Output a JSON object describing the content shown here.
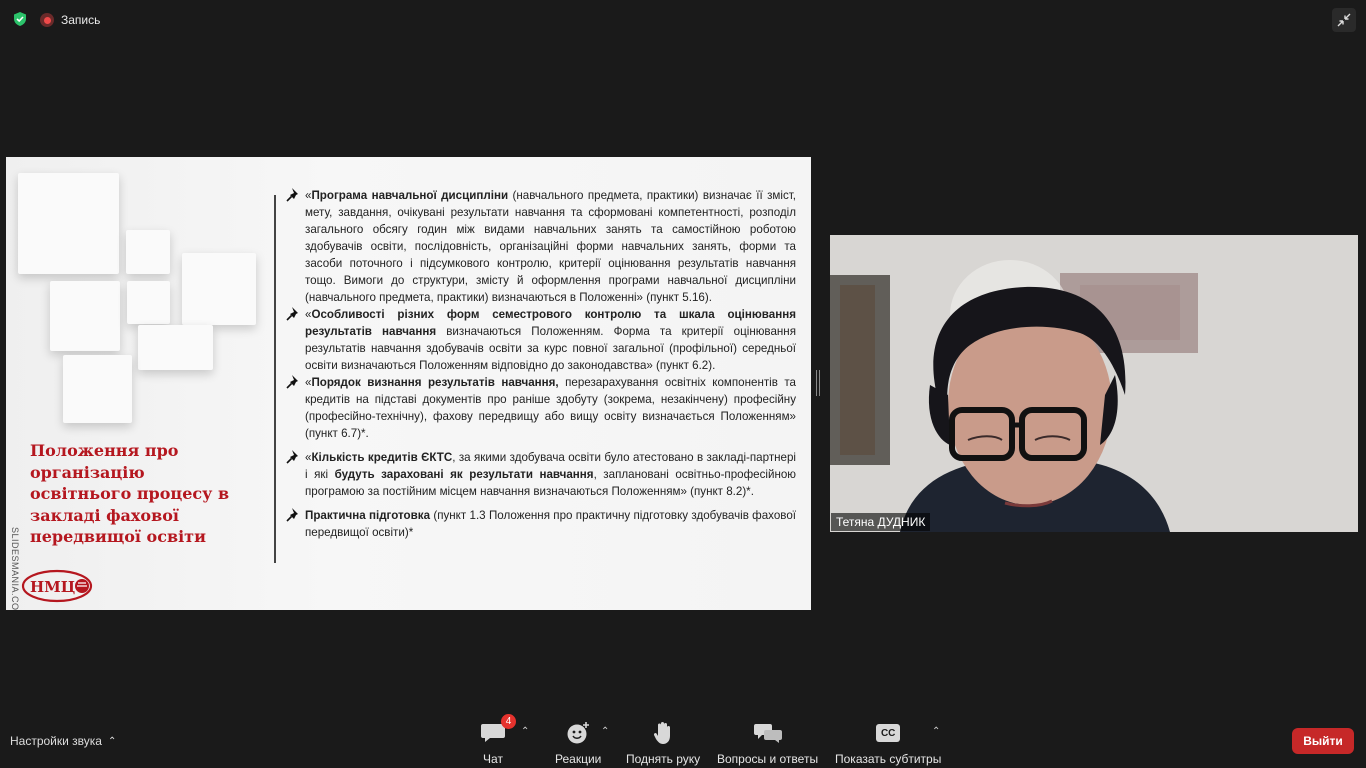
{
  "top": {
    "recording_label": "Запись"
  },
  "slide": {
    "title": "Положення про організацію освітнього процесу в закладі фахової передвищої освіти",
    "watermark": "SLIDESMANIA.COM",
    "logo_text": "НМЦ",
    "bullets": [
      {
        "parts": [
          {
            "t": "«",
            "b": false
          },
          {
            "t": "Програма навчальної дисципліни",
            "b": true
          },
          {
            "t": " (навчального предмета, практики) визначає її зміст, мету, завдання, очікувані результати навчання та сформовані компетентності, розподіл загального обсягу годин між видами навчальних занять та самостійною роботою здобувачів освіти, послідовність, організаційні форми навчальних занять, форми та засоби поточного і підсумкового контролю, критерії оцінювання результатів навчання тощо. Вимоги до структури, змісту й оформлення програми навчальної дисципліни (навчального предмета, практики) визначаються в Положенні» (пункт 5.16).",
            "b": false
          }
        ]
      },
      {
        "parts": [
          {
            "t": "«",
            "b": false
          },
          {
            "t": "Особливості різних форм семестрового контролю та шкала оцінювання результатів навчання",
            "b": true
          },
          {
            "t": " визначаються Положенням. Форма та критерії оцінювання результатів навчання здобувачів освіти за курс повної загальної (профільної) середньої освіти визначаються Положенням відповідно до законодавства» (пункт 6.2).",
            "b": false
          }
        ]
      },
      {
        "parts": [
          {
            "t": "«",
            "b": false
          },
          {
            "t": "Порядок визнання результатів навчання,",
            "b": true
          },
          {
            "t": " перезарахування освітніх компонентів та кредитів на підставі документів про раніше здобуту (зокрема, незакінчену) професійну (професійно-технічну), фахову передвищу або вищу освіту визначається Положенням» (пункт 6.7)*.",
            "b": false
          }
        ]
      },
      {
        "parts": [
          {
            "t": "«",
            "b": false
          },
          {
            "t": "Кількість кредитів ЄКТС",
            "b": true
          },
          {
            "t": ", за якими здобувача освіти було атестовано в закладі-партнері і які ",
            "b": false
          },
          {
            "t": "будуть зараховані як результати навчання",
            "b": true
          },
          {
            "t": ", заплановані освітньо-професійною програмою за постійним місцем навчання визначаються Положенням» (пункт 8.2)*.",
            "b": false
          }
        ]
      },
      {
        "parts": [
          {
            "t": "Практична підготовка",
            "b": true
          },
          {
            "t": " (пункт 1.3 Положення про практичну підготовку здобувачів фахової передвищої освіти)*",
            "b": false
          }
        ]
      }
    ]
  },
  "video": {
    "participant_name": "Тетяна ДУДНИК"
  },
  "bottom": {
    "audio_settings": "Настройки звука",
    "chat": "Чат",
    "chat_badge": "4",
    "reactions": "Реакции",
    "raise_hand": "Поднять руку",
    "qa": "Вопросы и ответы",
    "subtitles": "Показать субтитры",
    "cc_icon_text": "CC",
    "leave": "Выйти"
  }
}
